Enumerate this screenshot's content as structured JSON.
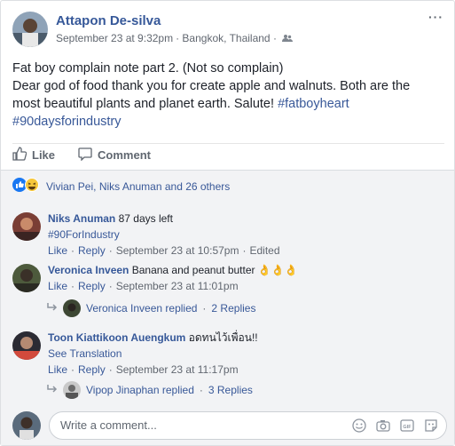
{
  "post": {
    "author": "Attapon De-silva",
    "timestamp": "September 23 at 9:32pm",
    "location": "· Bangkok, Thailand ·",
    "more_label": "···",
    "text_line1": "Fat boy complain note part 2. (Not so complain)",
    "text_line2": "Dear god of food thank you for create apple and walnuts. Both are the",
    "text_line3_plain": "most beautiful plants and planet earth. Salute! ",
    "hashtag1": "#fatboyheart",
    "hashtag2": "#90daysforindustry"
  },
  "actions": {
    "like": "Like",
    "comment": "Comment"
  },
  "reactions": {
    "summary": "Vivian Pei, Niks Anuman and 26 others"
  },
  "comments": [
    {
      "author": "Niks Anuman",
      "text": " 87 days left",
      "hashtag": "#90ForIndustry",
      "like": "Like",
      "reply": "Reply",
      "time": "September 23 at 10:57pm",
      "edited": "Edited"
    },
    {
      "author": "Veronica Inveen",
      "text": " Banana and peanut butter ",
      "emoji": "👌👌👌",
      "like": "Like",
      "reply": "Reply",
      "time": "September 23 at 11:01pm",
      "replies_author": "Veronica Inveen replied",
      "replies_count": "2 Replies"
    },
    {
      "author": "Toon Kiattikoon Auengkum",
      "text": " อดทนไว้เพื่อน!!",
      "see_translation": "See Translation",
      "like": "Like",
      "reply": "Reply",
      "time": "September 23 at 11:17pm",
      "replies_author": "Vipop Jinaphan replied",
      "replies_count": "3 Replies"
    }
  ],
  "composer": {
    "placeholder": "Write a comment..."
  },
  "colors": {
    "link": "#365899",
    "meta": "#616770",
    "comments_bg": "#f2f3f5",
    "like_blue": "#1877f2"
  }
}
